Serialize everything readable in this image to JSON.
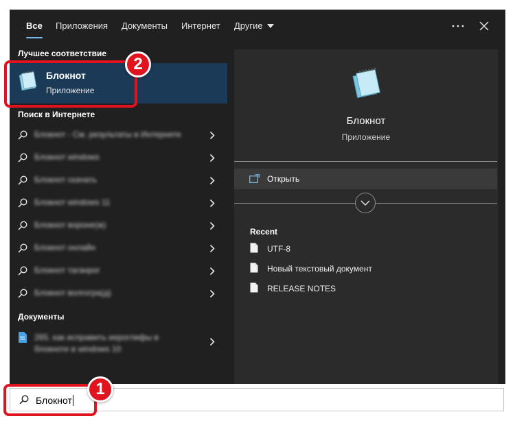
{
  "tabs": [
    {
      "label": "Все",
      "active": true
    },
    {
      "label": "Приложения"
    },
    {
      "label": "Документы"
    },
    {
      "label": "Интернет"
    },
    {
      "label": "Другие"
    }
  ],
  "header_icons": {
    "more": "more-dots-icon",
    "close": "close-icon"
  },
  "left": {
    "best_match_title": "Лучшее соответствие",
    "best_match": {
      "name": "Блокнот",
      "kind": "Приложение"
    },
    "web_title": "Поиск в Интернете",
    "web_results": [
      "Блокнот - См. результаты в Интернете",
      "Блокнот windows",
      "Блокнот скачать",
      "Блокнот windows 11",
      "Блокнот вороне(ж)",
      "Блокнот онлайн",
      "Блокнот таганрог",
      "Блокнот волгогра(д)"
    ],
    "docs_title": "Документы",
    "doc_result": "265. как исправить иероглифы в блокноте в windows 10"
  },
  "right": {
    "app_name": "Блокнот",
    "app_kind": "Приложение",
    "open_label": "Открыть",
    "recent_title": "Recent",
    "recent": [
      "UTF-8",
      "Новый текстовый документ",
      "RELEASE NOTES"
    ]
  },
  "search": {
    "value": "Блокнот"
  },
  "callouts": {
    "one": "1",
    "two": "2"
  },
  "colors": {
    "accent": "#76b9ed",
    "selected_bg": "#1b3a57",
    "highlight": "#e0141e"
  }
}
